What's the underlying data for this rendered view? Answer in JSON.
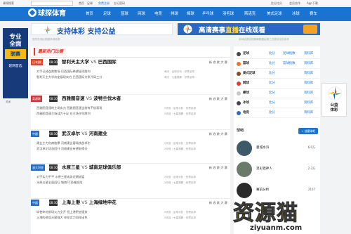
{
  "topbar": {
    "search_label": "球探搜索",
    "search_placeholder": "赛事名称/队名",
    "links": [
      "首页",
      "足球",
      "免费注册",
      "忘记密码"
    ],
    "right_links": [
      "比分比分",
      "会员合作",
      "App下载"
    ]
  },
  "nav": {
    "logo": "球探体育",
    "items": [
      "首页",
      "足球",
      "篮球",
      "网球",
      "电竞",
      "排球",
      "棒球",
      "乒乓球",
      "羽毛球",
      "斯诺克",
      "美式足球",
      "冰球",
      "赛车"
    ]
  },
  "banners": {
    "left": "支持体彩   支持公益",
    "right_prefix": "高清赛事",
    "right_highlight": "直播",
    "right_suffix": "在线观看"
  },
  "notices": {
    "left": "您所在地区根据体育政策",
    "right": "本网站提供的赛事数据由第三方提供仅供参考"
  },
  "left_ad": {
    "line1": "专业",
    "line2": "全面",
    "yellow": "联赛",
    "sub": "建网首选",
    "close": "关闭"
  },
  "right_ad": {
    "line1": "公益",
    "line2": "体彩"
  },
  "panel": {
    "title": "最新热门比赛",
    "matches": [
      {
        "league": "日本J联",
        "league_color": "#d84a2f",
        "time": "08:30",
        "home": "智利天主大学",
        "vs": " VS ",
        "away": "巴西国际",
        "links": "新 浪 欧 大 赛",
        "lines": [
          "对手已经连败数场 巴西国际希望延续胜利",
          "智利天主大学决定展现实力 巴西国际力争开局三分"
        ],
        "meta": [
          "两天 · 足球分析 · 世界足球",
          "两天 · 七星观察 · 世界足球"
        ]
      },
      {
        "league": "英超联",
        "league_color": "#c9383b",
        "time": "08:30",
        "home": "西雅图音速",
        "vs": " VS ",
        "away": "波特兰伐木者",
        "links": "新 浪 欧 大 赛",
        "lines": [
          "西雅图音速的主场实力 西雅图音速当前有不俗表现",
          "西雅图音速主场战力十足 在主场守住胜利"
        ],
        "meta": [
          "2天前 · 足球分析 · 世界足球",
          "2天前 · 七星观察 · 世界足球"
        ]
      },
      {
        "league": "中超",
        "league_color": "#2a6dc0",
        "time": "08:30",
        "home": "武汉卓尔",
        "vs": " VS ",
        "away": "河南建业",
        "links": "新 浪 欧 大 赛",
        "lines": [
          "建业主力伤病拖累 河南建业客场挑战卓尔",
          "武汉卓尔状态回升 河南建业有望取得分"
        ],
        "meta": [
          "2天前 · 足球分析 · 世界足球",
          "2天前 · 七星观察 · 世界足球"
        ]
      },
      {
        "league": "澳大利亚",
        "league_color": "#2a6dc0",
        "time": "08:30",
        "home": "水原三星",
        "vs": " VS ",
        "away": "城南足球俱乐部",
        "links": "新 浪 欧 大 赛",
        "lines": [
          "对手实力平平 水原三星攻势近期较猛",
          "水原三星全面回归 城南FC恐难抵挡"
        ],
        "meta": [
          "2天前 · 足球分析 · 世界足球",
          "2天前 · 七星观察 · 世界足球"
        ]
      },
      {
        "league": "中超",
        "league_color": "#2a6dc0",
        "time": "08:30",
        "home": "上海上港",
        "vs": " VS ",
        "away": "上海绿地申花",
        "links": "新 浪 欧 大 赛",
        "lines": [
          "纵使申花前场火力全开 但上港更加强势",
          "上港的进攻天赋强大 申花实力同样出色"
        ],
        "meta": [
          "2天前 · 足球分析 · 世界足球",
          "2天前 · 七星观察 · 世界足球"
        ]
      }
    ]
  },
  "sidebar": {
    "rows": [
      {
        "name": "足球",
        "color": "#444",
        "l1": "比分",
        "l2": "足球指数",
        "l3": "资料库"
      },
      {
        "name": "篮球",
        "color": "#e6772b",
        "l1": "比分",
        "l2": "篮球指数",
        "l3": "资料库"
      },
      {
        "name": "美式足球",
        "color": "#8b4a20",
        "l1": "比分",
        "l2": "",
        "l3": "资料库"
      },
      {
        "name": "网球",
        "color": "#e0382a",
        "l1": "比分",
        "l2": "",
        "l3": "资料库"
      },
      {
        "name": "棒球",
        "color": "#c8c8c8",
        "l1": "比分",
        "l2": "",
        "l3": "资料库"
      },
      {
        "name": "冰球",
        "color": "#444",
        "l1": "比分",
        "l2": "",
        "l3": "资料库"
      },
      {
        "name": "电竞",
        "color": "#2a6dc0",
        "l1": "比分",
        "l2": "",
        "l3": "资料库"
      }
    ]
  },
  "idols": {
    "title": "球吧",
    "button": "+ 创建球吧",
    "items": [
      {
        "name": "曼城水浒",
        "count": "6.0万",
        "color": "#3e5968"
      },
      {
        "name": "足彩猎神人",
        "count": "2.3万",
        "color": "#6b7a6a"
      },
      {
        "name": "赛前分析",
        "count": "2107",
        "color": "#2b2b2b"
      }
    ]
  },
  "watermark": {
    "big": "资源猫",
    "small": "ziyuanm.com"
  }
}
